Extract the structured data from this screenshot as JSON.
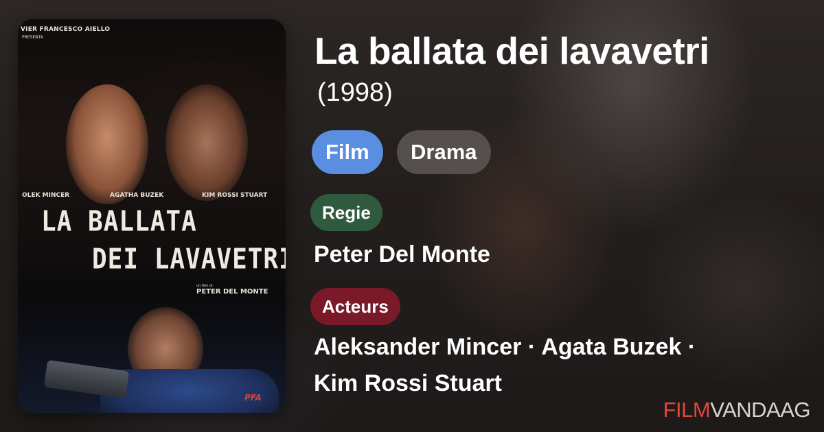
{
  "movie": {
    "title": "La ballata dei lavavetri",
    "year": "(1998)"
  },
  "tags": [
    {
      "label": "Film",
      "color": "#5a8ee0"
    },
    {
      "label": "Drama",
      "color": "#55504e"
    }
  ],
  "sections": {
    "regie": {
      "label": "Regie",
      "color": "#2f5a3e",
      "value": "Peter Del Monte"
    },
    "acteurs": {
      "label": "Acteurs",
      "color": "#7a1a28",
      "line1": "Aleksander Mincer · Agata Buzek ·",
      "line2": "Kim Rossi Stuart"
    }
  },
  "poster": {
    "presenter": "VIER FRANCESCO AIELLO",
    "presenta": "PRESENTA",
    "cast": [
      "OLEK MINCER",
      "AGATHA BUZEK",
      "KIM ROSSI STUART"
    ],
    "title_line1": "LA BALLATA",
    "title_line2": "DEI LAVAVETRI",
    "film_by": "un film di",
    "director": "PETER DEL MONTE",
    "distributor": "PFA"
  },
  "brand": {
    "part1": "FILM",
    "part2": "VANDAAG",
    "accent": "#e0463a"
  }
}
